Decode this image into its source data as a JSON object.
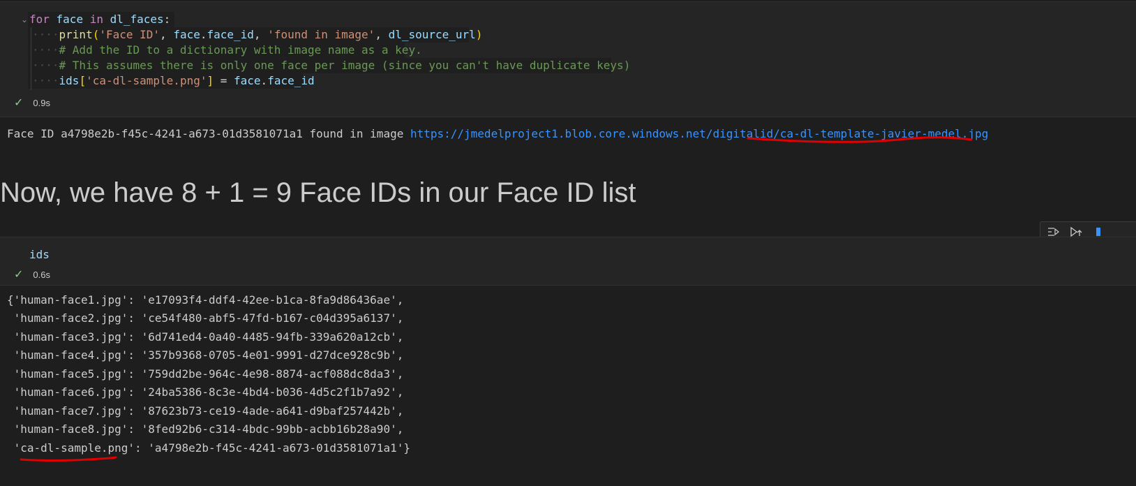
{
  "cell1": {
    "lines": [
      {
        "t1": "for",
        "t2": " face ",
        "t3": "in",
        "t4": " dl_faces",
        "t5": ":"
      },
      {
        "fn": "print",
        "open": "(",
        "s1": "'Face ID'",
        "c1": ", ",
        "v1": "face",
        "d1": ".",
        "v2": "face_id",
        "c2": ", ",
        "s2": "'found in image'",
        "c3": ", ",
        "v3": "dl_source_url",
        "close": ")"
      },
      {
        "comment": "# Add the ID to a dictionary with image name as a key."
      },
      {
        "comment": "# This assumes there is only one face per image (since you can't have duplicate keys)"
      },
      {
        "v1": "ids",
        "open": "[",
        "s1": "'ca-dl-sample.png'",
        "close": "]",
        "eq": " = ",
        "v2": "face",
        "d": ".",
        "v3": "face_id"
      }
    ],
    "status_time": "0.9s"
  },
  "output1": {
    "prefix": "Face ID a4798e2b-f45c-4241-a673-01d3581071a1 found in image ",
    "url": "https://jmedelproject1.blob.core.windows.net/digitalid/ca-dl-template-javier-medel.jpg"
  },
  "markdown": {
    "heading": "Now, we have 8 + 1 = 9 Face IDs in our Face ID list"
  },
  "cell2": {
    "code": "ids",
    "status_time": "0.6s"
  },
  "output2": {
    "lines": [
      "{'human-face1.jpg': 'e17093f4-ddf4-42ee-b1ca-8fa9d86436ae',",
      " 'human-face2.jpg': 'ce54f480-abf5-47fd-b167-c04d395a6137',",
      " 'human-face3.jpg': '6d741ed4-0a40-4485-94fb-339a620a12cb',",
      " 'human-face4.jpg': '357b9368-0705-4e01-9991-d27dce928c9b',",
      " 'human-face5.jpg': '759dd2be-964c-4e98-8874-acf088dc8da3',",
      " 'human-face6.jpg': '24ba5386-8c3e-4bd4-b036-4d5c2f1b7a92',",
      " 'human-face7.jpg': '87623b73-ce19-4ade-a641-d9baf257442b',",
      " 'human-face8.jpg': '8fed92b6-c314-4bdc-99bb-acbb16b28a90',",
      " 'ca-dl-sample.png': 'a4798e2b-f45c-4241-a673-01d3581071a1'}"
    ]
  },
  "toolbar": {
    "icons": [
      "execute-above-icon",
      "execute-cell-below-icon"
    ]
  },
  "colors": {
    "background": "#1e1e1e",
    "cell_background": "#252526",
    "link": "#3794ff",
    "annotation": "#e00000",
    "check": "#89d185"
  }
}
